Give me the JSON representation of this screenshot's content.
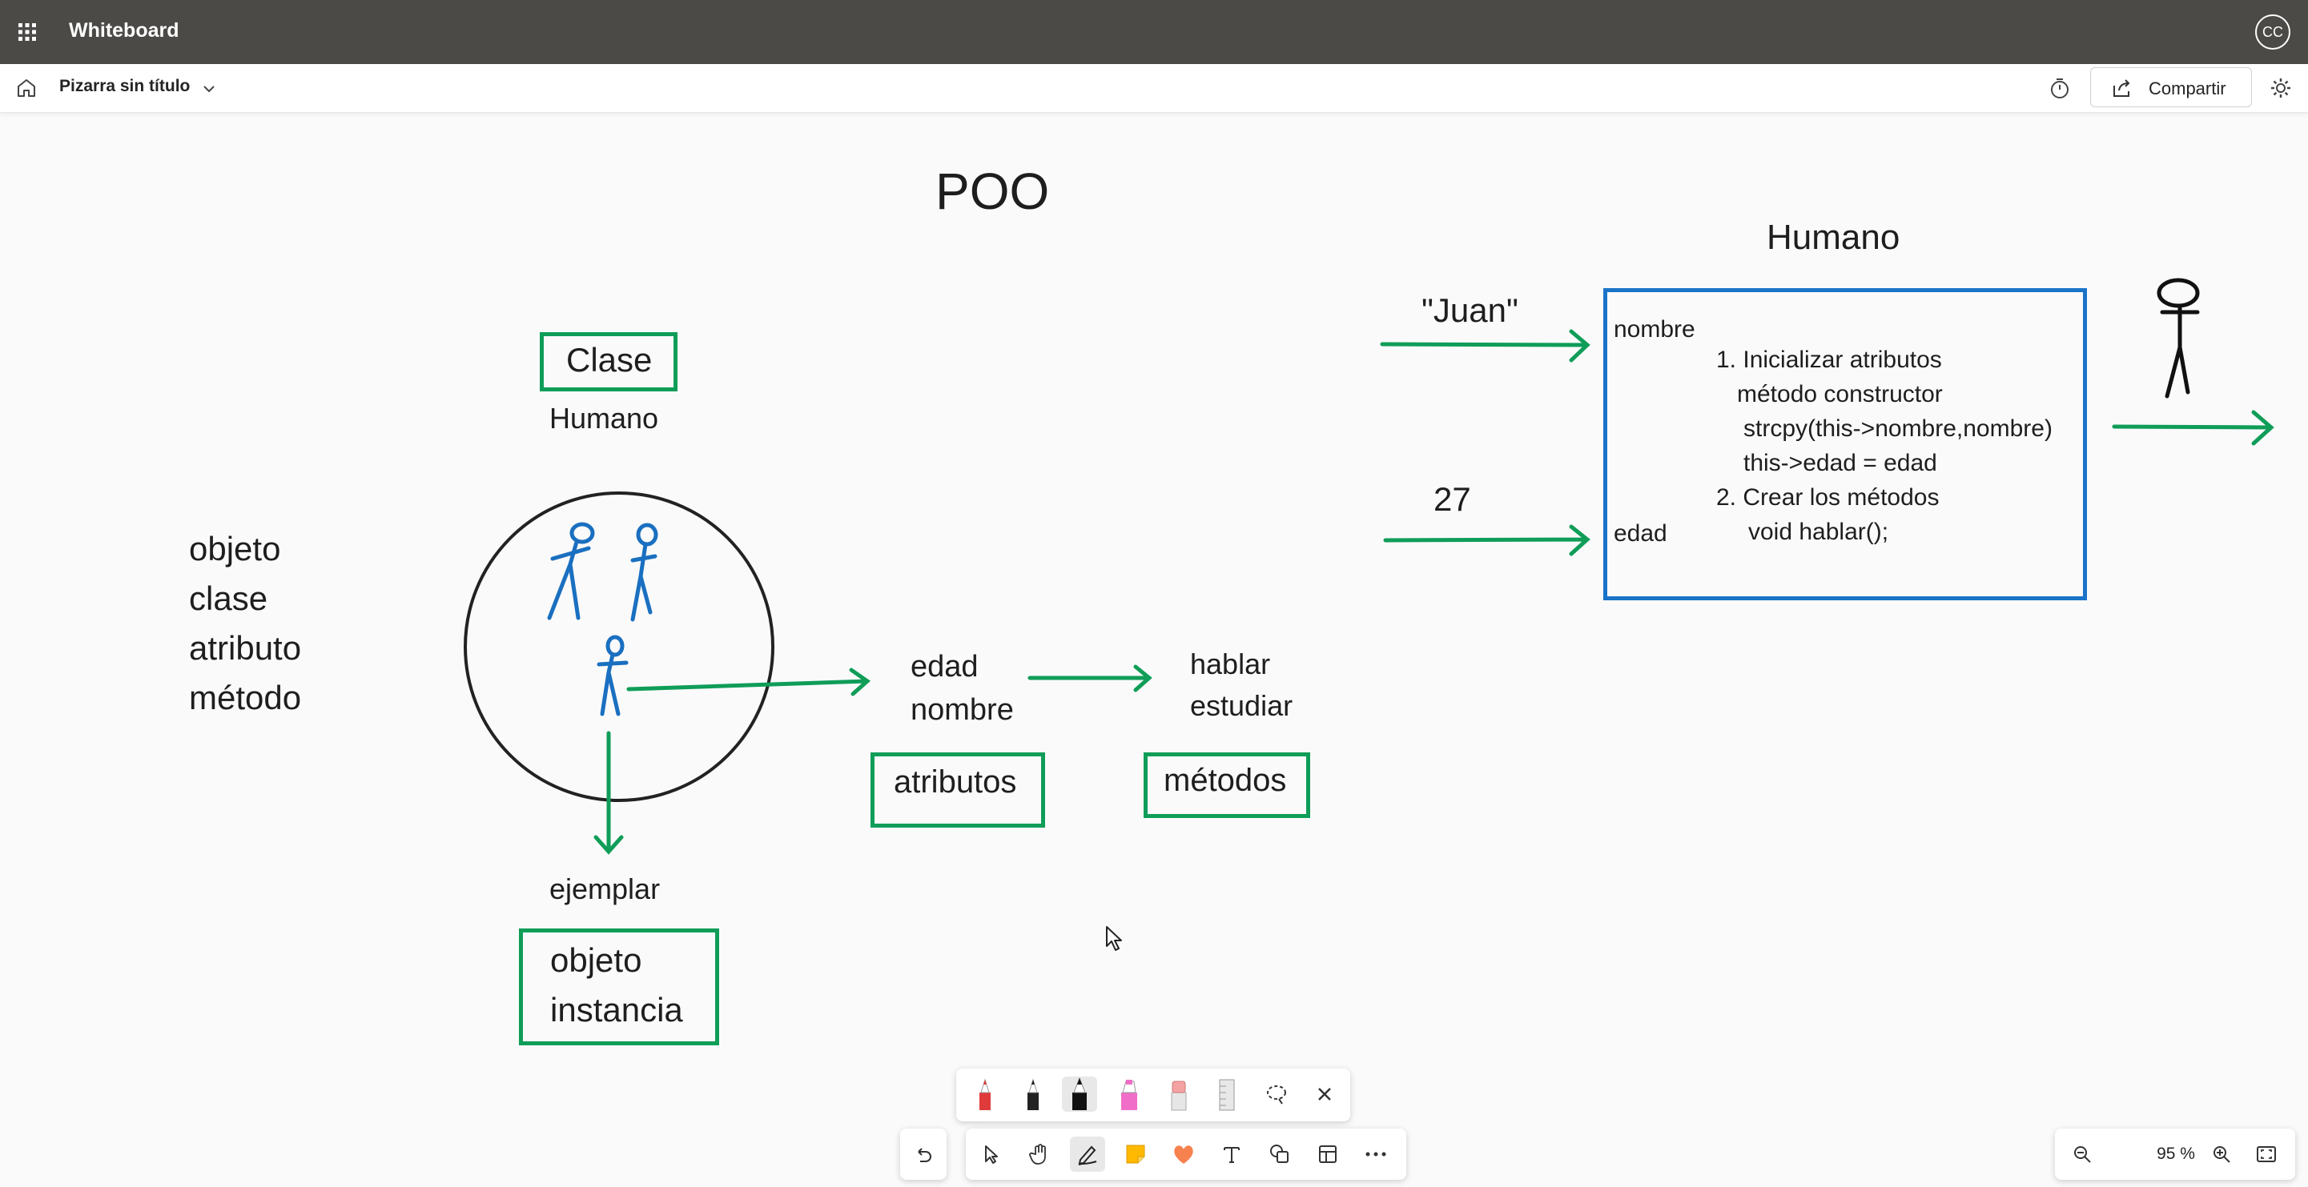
{
  "app": {
    "title": "Whiteboard",
    "avatar_initials": "CC"
  },
  "command_bar": {
    "board_title": "Pizarra sin título",
    "share_label": "Compartir"
  },
  "whiteboard": {
    "main_title": "POO",
    "concept_list": [
      "objeto",
      "clase",
      "atributo",
      "método"
    ],
    "class_box_label": "Clase",
    "class_name": "Humano",
    "instance_label": "ejemplar",
    "object_box_lines": [
      "objeto",
      "instancia"
    ],
    "attributes": [
      "edad",
      "nombre"
    ],
    "attributes_box": "atributos",
    "methods": [
      "hablar",
      "estudiar"
    ],
    "methods_box": "métodos",
    "constructor_section": {
      "class_title": "Humano",
      "input_name": "\"Juan\"",
      "input_age": "27",
      "param_name": "nombre",
      "param_age": "edad",
      "steps": [
        "1. Inicializar atributos",
        "método constructor",
        "strcpy(this->nombre,nombre)",
        "this->edad = edad",
        "2. Crear los métodos",
        "void hablar();"
      ]
    },
    "colors": {
      "green": "#0f9d58",
      "blue": "#1a73c8",
      "ink": "#1e1e1e"
    }
  },
  "pen_tray": {
    "tools": [
      "red-pen-icon",
      "black-pen-icon",
      "black-marker-icon",
      "pink-highlighter-icon",
      "eraser-icon",
      "ruler-icon",
      "lasso-icon",
      "close-icon"
    ]
  },
  "main_toolbar": {
    "tools": [
      "undo-icon",
      "select-icon",
      "hand-icon",
      "inking-icon",
      "sticky-note-icon",
      "reactions-icon",
      "text-icon",
      "shapes-icon",
      "templates-icon",
      "more-icon"
    ]
  },
  "zoom": {
    "level": "95 %"
  }
}
